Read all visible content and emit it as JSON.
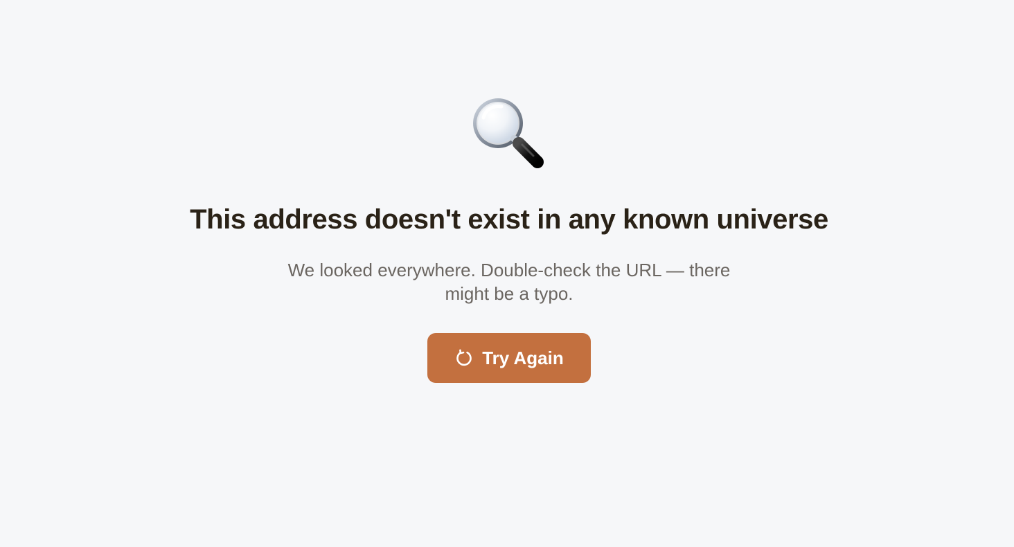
{
  "icons": {
    "hero": "magnifying-glass-icon",
    "button": "refresh-icon"
  },
  "content": {
    "title": "This address doesn't exist in any known universe",
    "message_line_1": "We looked everywhere. Double-check the URL — there",
    "message_line_2": "might be a typo.",
    "button_label": "Try Again"
  },
  "colors": {
    "background": "#f6f7f9",
    "title": "#2a2217",
    "message": "#6b6661",
    "accent": "#c3703f"
  }
}
